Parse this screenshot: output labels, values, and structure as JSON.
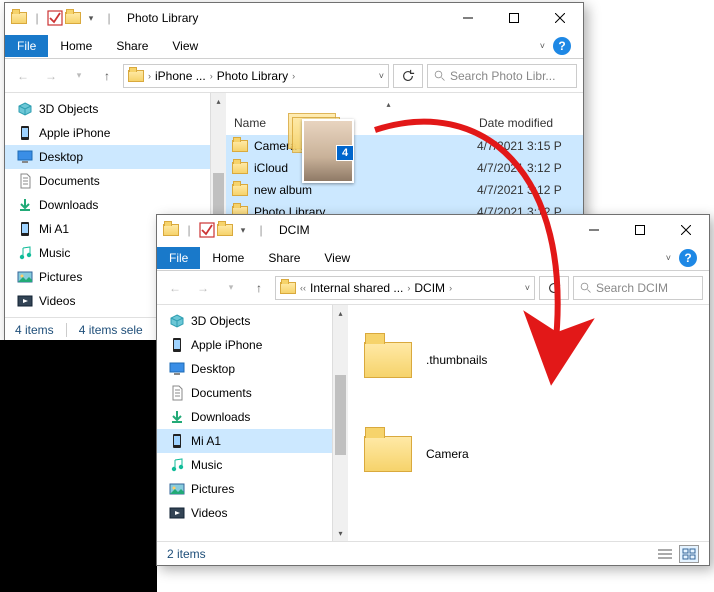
{
  "win1": {
    "title": "Photo Library",
    "tabs": {
      "file": "File",
      "home": "Home",
      "share": "Share",
      "view": "View"
    },
    "crumbs": [
      "iPhone ...",
      "Photo Library"
    ],
    "searchPlaceholder": "Search Photo Libr...",
    "cols": {
      "name": "Name",
      "date": "Date modified"
    },
    "rows": [
      {
        "name": "Camera Roll",
        "date": "4/7/2021 3:15 P"
      },
      {
        "name": "iCloud",
        "date": "4/7/2021 3:12 P"
      },
      {
        "name": "new album",
        "date": "4/7/2021 3:12 P"
      },
      {
        "name": "Photo Library",
        "date": "4/7/2021 3:12 P"
      }
    ],
    "drag_count": "4",
    "status_items": "4 items",
    "status_selected": "4 items sele"
  },
  "win2": {
    "title": "DCIM",
    "tabs": {
      "file": "File",
      "home": "Home",
      "share": "Share",
      "view": "View"
    },
    "crumbs": [
      "Internal shared ...",
      "DCIM"
    ],
    "searchPlaceholder": "Search DCIM",
    "items": [
      {
        "name": ".thumbnails"
      },
      {
        "name": "Camera"
      }
    ],
    "status_items": "2 items"
  },
  "sidebar": {
    "items": [
      {
        "label": "3D Objects"
      },
      {
        "label": "Apple iPhone"
      },
      {
        "label": "Desktop"
      },
      {
        "label": "Documents"
      },
      {
        "label": "Downloads"
      },
      {
        "label": "Mi A1"
      },
      {
        "label": "Music"
      },
      {
        "label": "Pictures"
      },
      {
        "label": "Videos"
      }
    ]
  }
}
